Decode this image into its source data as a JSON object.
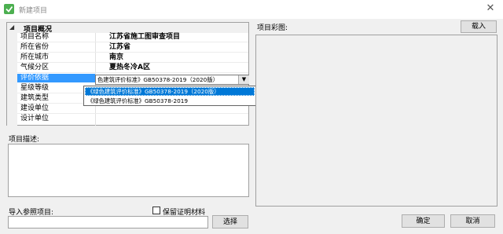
{
  "window": {
    "title": "新建项目",
    "close_glyph": "✕"
  },
  "property_grid": {
    "category": "项目概况",
    "rows": [
      {
        "label": "项目名称",
        "value": "江苏省施工图审查项目"
      },
      {
        "label": "所在省份",
        "value": "江苏省"
      },
      {
        "label": "所在城市",
        "value": "南京"
      },
      {
        "label": "气候分区",
        "value": "夏热冬冷A区"
      },
      {
        "label": "评价依据",
        "value": ""
      },
      {
        "label": "星级等级",
        "value": ""
      },
      {
        "label": "建筑类型",
        "value": ""
      },
      {
        "label": "建设单位",
        "value": ""
      },
      {
        "label": "设计单位",
        "value": ""
      }
    ],
    "combo": {
      "text": "色建筑评价标准》GB50378-2019（2020版）",
      "options": [
        "《绿色建筑评价标准》GB50378-2019（2020版）",
        "《绿色建筑评价标准》GB50378-2019"
      ]
    }
  },
  "project_image": {
    "label": "项目彩图:",
    "load_button": "载入"
  },
  "description": {
    "label": "项目描述:"
  },
  "import": {
    "label": "导入参照项目:",
    "keep_cert_label": "保留证明材料",
    "select_button": "选择"
  },
  "buttons": {
    "ok": "确定",
    "cancel": "取消"
  },
  "colors": {
    "selection": "#3399ff",
    "dropdown_selection": "#0078d7",
    "app_icon": "#4caf50"
  }
}
